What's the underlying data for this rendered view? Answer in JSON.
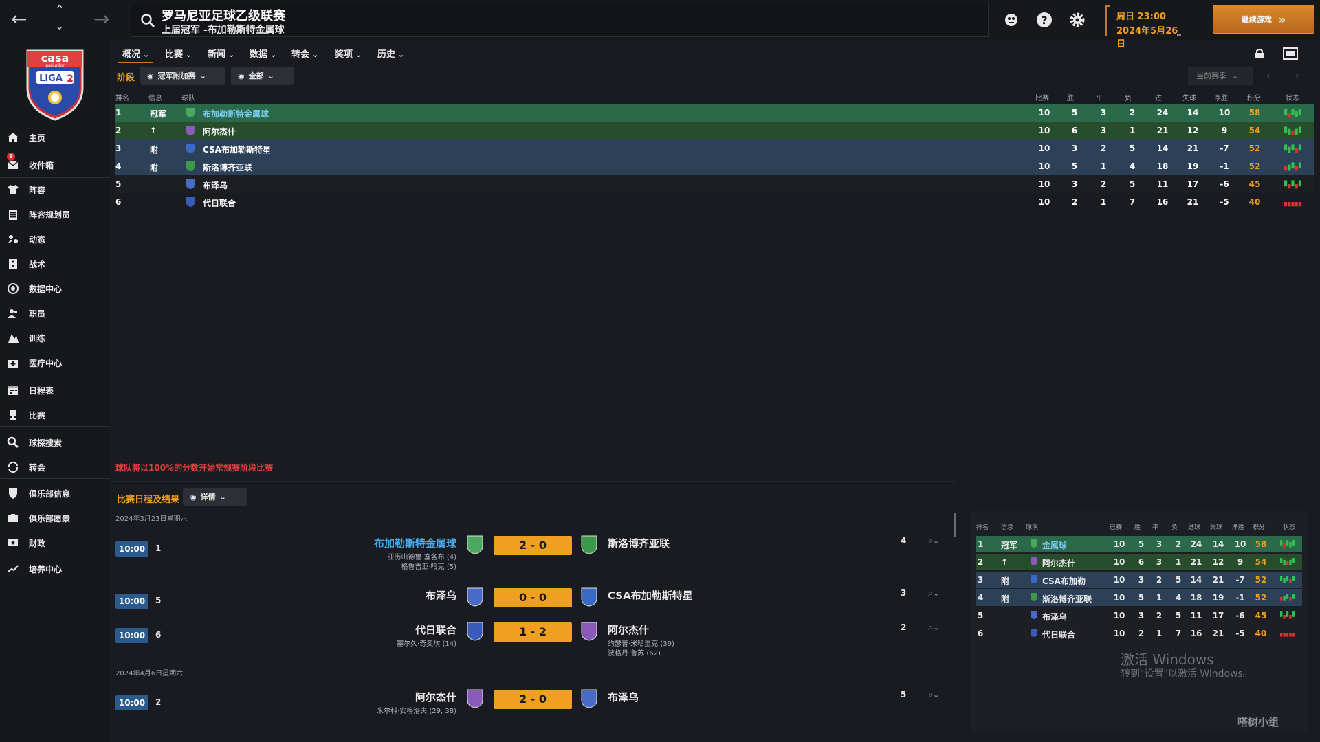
{
  "header": {
    "title": "罗马尼亚足球乙级联赛",
    "subtitle": "上届冠军 -布加勒斯特金属球",
    "date_line1": "周日 23:00",
    "date_line2": "2024年5月26日",
    "continue_label": "继续游戏"
  },
  "sidebar": {
    "logo_lines": [
      "casa",
      "pariurilor",
      "LIGA",
      "2"
    ],
    "inbox_badge": "9",
    "items": [
      {
        "label": "主页",
        "icon": "home-icon"
      },
      {
        "label": "收件箱",
        "icon": "inbox-icon"
      },
      {
        "label": "阵容",
        "icon": "shirt-icon"
      },
      {
        "label": "阵容规划员",
        "icon": "clipboard-icon"
      },
      {
        "label": "动态",
        "icon": "dynamics-icon"
      },
      {
        "label": "战术",
        "icon": "tactics-icon"
      },
      {
        "label": "数据中心",
        "icon": "data-hub-icon"
      },
      {
        "label": "职员",
        "icon": "staff-icon"
      },
      {
        "label": "训练",
        "icon": "training-icon"
      },
      {
        "label": "医疗中心",
        "icon": "medical-icon"
      },
      {
        "label": "日程表",
        "icon": "calendar-icon"
      },
      {
        "label": "比赛",
        "icon": "trophy-icon"
      },
      {
        "label": "球探搜索",
        "icon": "search-icon"
      },
      {
        "label": "转会",
        "icon": "transfer-icon"
      },
      {
        "label": "俱乐部信息",
        "icon": "club-info-icon"
      },
      {
        "label": "俱乐部愿景",
        "icon": "club-vision-icon"
      },
      {
        "label": "财政",
        "icon": "finance-icon"
      },
      {
        "label": "培养中心",
        "icon": "development-icon"
      }
    ]
  },
  "subnav": [
    "概况",
    "比赛",
    "新闻",
    "数据",
    "转会",
    "奖项",
    "历史"
  ],
  "stage": {
    "label": "阶段",
    "filter1": "冠军附加赛",
    "filter2": "全部",
    "season": "当前赛季"
  },
  "table": {
    "headers": {
      "pos": "排名",
      "info": "信息",
      "team": "球队",
      "pld": "比赛",
      "w": "胜",
      "d": "平",
      "l": "负",
      "gf": "进",
      "ga": "失球",
      "gd": "净胜",
      "pts": "积分",
      "form": "状态"
    },
    "rows": [
      {
        "pos": "1",
        "info": "冠军",
        "team": "布加勒斯特金属球",
        "pld": "10",
        "w": "5",
        "d": "3",
        "l": "2",
        "gf": "24",
        "ga": "14",
        "gd": "10",
        "pts": "58",
        "bg": "#2a6a4a",
        "crest": "#4aa860"
      },
      {
        "pos": "2",
        "info": "↑",
        "team": "阿尔杰什",
        "pld": "10",
        "w": "6",
        "d": "3",
        "l": "1",
        "gf": "21",
        "ga": "12",
        "gd": "9",
        "pts": "54",
        "bg": "#284d2c",
        "crest": "#8a5ab8"
      },
      {
        "pos": "3",
        "info": "附",
        "team": "CSA布加勒斯特星",
        "pld": "10",
        "w": "3",
        "d": "2",
        "l": "5",
        "gf": "14",
        "ga": "21",
        "gd": "-7",
        "pts": "52",
        "bg": "#2c4058",
        "crest": "#3a6ac8"
      },
      {
        "pos": "4",
        "info": "附",
        "team": "斯洛博齐亚联",
        "pld": "10",
        "w": "5",
        "d": "1",
        "l": "4",
        "gf": "18",
        "ga": "19",
        "gd": "-1",
        "pts": "52",
        "bg": "#2c4058",
        "crest": "#3a9a4a"
      },
      {
        "pos": "5",
        "info": "",
        "team": "布泽乌",
        "pld": "10",
        "w": "3",
        "d": "2",
        "l": "5",
        "gf": "11",
        "ga": "17",
        "gd": "-6",
        "pts": "45",
        "bg": "#1c1e22",
        "crest": "#4a6ac8"
      },
      {
        "pos": "6",
        "info": "",
        "team": "代日联合",
        "pld": "10",
        "w": "2",
        "d": "1",
        "l": "7",
        "gf": "16",
        "ga": "21",
        "gd": "-5",
        "pts": "40",
        "bg": "#191b20",
        "crest": "#3a5ab8"
      }
    ]
  },
  "note": "球队将以100%的分数开始常规赛阶段比赛",
  "fixtures": {
    "label": "比赛日程及结果",
    "detail_label": "详情",
    "groups": [
      {
        "date": "2024年3月23日星期六"
      },
      {
        "date": "2024年4月6日星期六"
      }
    ],
    "matches": [
      {
        "time": "10:00",
        "num": "1",
        "home": "布加勒斯特金属球",
        "score": "2 - 0",
        "away": "斯洛博齐亚联",
        "home_scorers": [
          "亚历山德鲁·塞各布 (4)",
          "格鲁吉亚·哈克 (5)"
        ],
        "away_scorers": [],
        "rating": "4",
        "home_crest": "#4aa860",
        "away_crest": "#3a9a4a",
        "highlight": true
      },
      {
        "time": "10:00",
        "num": "5",
        "home": "布泽乌",
        "score": "0 - 0",
        "away": "CSA布加勒斯特星",
        "home_scorers": [],
        "away_scorers": [],
        "rating": "3",
        "home_crest": "#4a6ac8",
        "away_crest": "#3a6ac8",
        "highlight": false
      },
      {
        "time": "10:00",
        "num": "6",
        "home": "代日联合",
        "score": "1 - 2",
        "away": "阿尔杰什",
        "home_scorers": [
          "塞尔久·奇奥坎 (14)"
        ],
        "away_scorers": [
          "约瑟普·米哈里克 (39)",
          "波格丹·鲁苏 (62)"
        ],
        "rating": "2",
        "home_crest": "#3a5ab8",
        "away_crest": "#8a5ab8",
        "highlight": false
      },
      {
        "time": "10:00",
        "num": "2",
        "home": "阿尔杰什",
        "score": "2 - 0",
        "away": "布泽乌",
        "home_scorers": [
          "米尔科·安格洛夫 (29, 38)"
        ],
        "away_scorers": [],
        "rating": "5",
        "home_crest": "#8a5ab8",
        "away_crest": "#4a6ac8",
        "highlight": false
      }
    ]
  },
  "mini_table": {
    "headers": {
      "pos": "排名",
      "info": "信息",
      "team": "球队",
      "pld": "已赛",
      "w": "胜",
      "d": "平",
      "l": "负",
      "gf": "进球",
      "ga": "失球",
      "gd": "净胜",
      "pts": "积分",
      "form": "状态"
    },
    "rows": [
      {
        "pos": "1",
        "info": "冠军",
        "team": "金属球",
        "pld": "10",
        "w": "5",
        "d": "3",
        "l": "2",
        "gf": "24",
        "ga": "14",
        "gd": "10",
        "pts": "58",
        "bg": "#2a6a4a",
        "crest": "#4aa860"
      },
      {
        "pos": "2",
        "info": "↑",
        "team": "阿尔杰什",
        "pld": "10",
        "w": "6",
        "d": "3",
        "l": "1",
        "gf": "21",
        "ga": "12",
        "gd": "9",
        "pts": "54",
        "bg": "#284d2c",
        "crest": "#8a5ab8"
      },
      {
        "pos": "3",
        "info": "附",
        "team": "CSA布加勒",
        "pld": "10",
        "w": "3",
        "d": "2",
        "l": "5",
        "gf": "14",
        "ga": "21",
        "gd": "-7",
        "pts": "52",
        "bg": "#2c4058",
        "crest": "#3a6ac8"
      },
      {
        "pos": "4",
        "info": "附",
        "team": "斯洛博齐亚联",
        "pld": "10",
        "w": "5",
        "d": "1",
        "l": "4",
        "gf": "18",
        "ga": "19",
        "gd": "-1",
        "pts": "52",
        "bg": "#2c4058",
        "crest": "#3a9a4a"
      },
      {
        "pos": "5",
        "info": "",
        "team": "布泽乌",
        "pld": "10",
        "w": "3",
        "d": "2",
        "l": "5",
        "gf": "11",
        "ga": "17",
        "gd": "-6",
        "pts": "45",
        "bg": "#1d1f24",
        "crest": "#4a6ac8"
      },
      {
        "pos": "6",
        "info": "",
        "team": "代日联合",
        "pld": "10",
        "w": "2",
        "d": "1",
        "l": "7",
        "gf": "16",
        "ga": "21",
        "gd": "-5",
        "pts": "40",
        "bg": "#1d1f24",
        "crest": "#3a5ab8"
      }
    ]
  },
  "windows_activation": {
    "line1": "激活 Windows",
    "line2": "转到\"设置\"以激活 Windows。"
  },
  "watermark": "嗒树小组"
}
